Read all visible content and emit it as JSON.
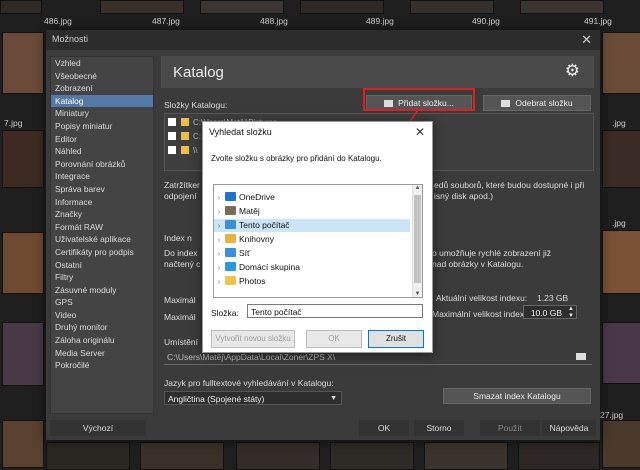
{
  "thumbnails": {
    "top_labels": [
      "486.jpg",
      "487.jpg",
      "488.jpg",
      "489.jpg",
      "490.jpg",
      "491.jpg"
    ],
    "left_edge_label": "7.jpg",
    "right_edge_labels": [
      ".jpg",
      ".jpg",
      ".jpg",
      ".jpg",
      ".jpg",
      ".jpg",
      "27.jpg"
    ]
  },
  "options_dialog": {
    "title": "Možnosti",
    "close_glyph": "✕",
    "sidebar_items": [
      "Vzhled",
      "Všeobecné",
      "Zobrazení",
      "Katalog",
      "Miniatury",
      "Popisy miniatur",
      "Editor",
      "Náhled",
      "Porovnání obrázků",
      "Integrace",
      "Správa barev",
      "Informace",
      "Značky",
      "Formát RAW",
      "Uživatelské aplikace",
      "Certifikáty pro podpis",
      "Ostatní",
      "Filtry",
      "Zásuvné moduly",
      "GPS",
      "Video",
      "Druhý monitor",
      "Záloha originálu",
      "Media Server",
      "Pokročilé"
    ],
    "selected_sidebar_index": 3,
    "header_title": "Katalog",
    "header_icon": "gear-icon",
    "folders_label": "Složky Katalogu:",
    "add_folder_label": "Přidat složku...",
    "remove_folder_label": "Odebrat složku",
    "folder_rows": [
      "C:\\Users\\Matěj\\Pictures",
      "C:",
      "\\\\"
    ],
    "note_text_1": "Zatržítker",
    "note_text_2": "odpojení",
    "note_right_1": "edů souborů, které budou dostupné i při",
    "note_right_2": "isný disk apod.)",
    "index_group_label": "Index n",
    "index_text_1": "Do index",
    "index_text_2": "načtený c",
    "index_right_1": "o umožňuje rychlé zobrazení již",
    "index_right_2": "nad obrázky v Katalogu.",
    "max_label_1": "Maximál",
    "max_label_2": "Maximál",
    "current_index_label": "Aktuální velikost indexu:",
    "current_index_value": "1.23 GB",
    "max_index_label": "Maximální velikost indexu:",
    "max_index_value": "10.0 GB",
    "location_label": "Umístění",
    "location_path": "C:\\Users\\Matěj\\AppData\\Local\\Zoner\\ZPS X\\",
    "language_label": "Jazyk pro fulltextové vyhledávání v Katalogu:",
    "language_value": "Angličtina (Spojené státy)",
    "clear_index_label": "Smazat index Katalogu",
    "default_label": "Výchozí",
    "ok_label": "OK",
    "cancel_label": "Storno",
    "apply_label": "Použít",
    "help_label": "Nápověda"
  },
  "folder_dialog": {
    "title": "Vyhledat složku",
    "close_glyph": "✕",
    "description": "Zvolte složku s obrázky pro přidání do Katalogu.",
    "tree": [
      {
        "label": "OneDrive",
        "icon": "cloud-icon",
        "color": "#1e73d2"
      },
      {
        "label": "Matěj",
        "icon": "user-icon",
        "color": "#7a6a5a"
      },
      {
        "label": "Tento počítač",
        "icon": "computer-icon",
        "color": "#3a8fd8"
      },
      {
        "label": "Knihovny",
        "icon": "library-icon",
        "color": "#e8b23c"
      },
      {
        "label": "Síť",
        "icon": "network-icon",
        "color": "#3a8fd8"
      },
      {
        "label": "Domácí skupina",
        "icon": "homegroup-icon",
        "color": "#2a9ad8"
      },
      {
        "label": "Photos",
        "icon": "folder-icon",
        "color": "#f0c44c"
      }
    ],
    "selected_index": 2,
    "folder_label": "Složka:",
    "folder_value": "Tento počítač",
    "new_folder_label": "Vytvořit novou složku",
    "ok_label": "OK",
    "cancel_label": "Zrušit"
  },
  "colors": {
    "selection": "#5478a8",
    "annotation": "#e02020",
    "tree_selection": "#cce4f7"
  }
}
